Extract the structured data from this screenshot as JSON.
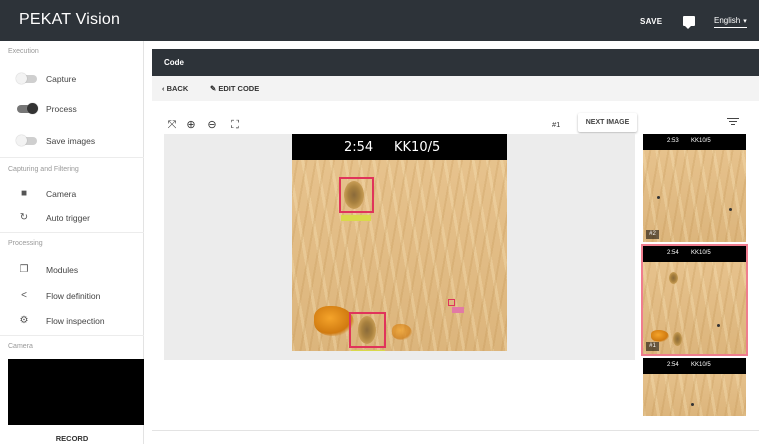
{
  "app": {
    "title": "PEKAT Vision",
    "save_label": "SAVE",
    "language": "English"
  },
  "sidebar": {
    "sections": [
      {
        "title": "Execution",
        "items": [
          {
            "label": "Capture",
            "control": "toggle",
            "on": false
          },
          {
            "label": "Process",
            "control": "toggle",
            "on": true
          },
          {
            "label": "Save images",
            "control": "toggle",
            "on": false
          }
        ]
      },
      {
        "title": "Capturing and Filtering",
        "items": [
          {
            "label": "Camera",
            "icon": "camera-icon"
          },
          {
            "label": "Auto trigger",
            "icon": "refresh-icon"
          }
        ]
      },
      {
        "title": "Processing",
        "items": [
          {
            "label": "Modules",
            "icon": "copy-icon"
          },
          {
            "label": "Flow definition",
            "icon": "share-icon"
          },
          {
            "label": "Flow inspection",
            "icon": "gear-icon"
          }
        ]
      },
      {
        "title": "Camera",
        "items": []
      }
    ],
    "record_label": "RECORD"
  },
  "main": {
    "title": "Code",
    "back_label": "BACK",
    "edit_label": "EDIT CODE",
    "image_number": "#1",
    "next_image_label": "NEXT IMAGE",
    "tools": [
      "fit-screen-icon",
      "zoom-in-icon",
      "zoom-out-icon",
      "fullscreen-icon"
    ],
    "image": {
      "timestamp": "2:54",
      "id": "KK10/5"
    },
    "thumbnails": [
      {
        "timestamp": "2:53",
        "id": "KK10/5",
        "badge": "#2",
        "selected": false
      },
      {
        "timestamp": "2:54",
        "id": "KK10/5",
        "badge": "#1",
        "selected": true
      },
      {
        "timestamp": "2:54",
        "id": "KK10/5",
        "badge": "",
        "selected": false
      }
    ]
  },
  "colors": {
    "topbar": "#2d3339",
    "detection": "#e0345b",
    "label_bg": "#d9d94a",
    "selected_thumb": "#ef7d8e"
  }
}
